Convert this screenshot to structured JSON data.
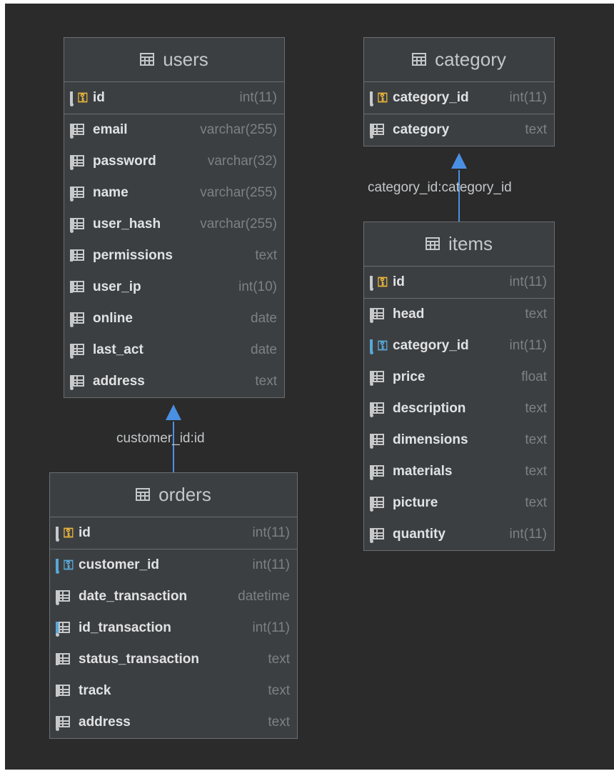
{
  "tables": {
    "users": {
      "name": "users",
      "pk": [
        {
          "name": "id",
          "type": "int(11)"
        }
      ],
      "cols": [
        {
          "name": "email",
          "type": "varchar(255)"
        },
        {
          "name": "password",
          "type": "varchar(32)"
        },
        {
          "name": "name",
          "type": "varchar(255)"
        },
        {
          "name": "user_hash",
          "type": "varchar(255)"
        },
        {
          "name": "permissions",
          "type": "text"
        },
        {
          "name": "user_ip",
          "type": "int(10)"
        },
        {
          "name": "online",
          "type": "date"
        },
        {
          "name": "last_act",
          "type": "date"
        },
        {
          "name": "address",
          "type": "text"
        }
      ]
    },
    "category": {
      "name": "category",
      "pk": [
        {
          "name": "category_id",
          "type": "int(11)"
        }
      ],
      "cols": [
        {
          "name": "category",
          "type": "text"
        }
      ]
    },
    "items": {
      "name": "items",
      "pk": [
        {
          "name": "id",
          "type": "int(11)"
        }
      ],
      "cols": [
        {
          "name": "head",
          "type": "text"
        },
        {
          "name": "category_id",
          "type": "int(11)"
        },
        {
          "name": "price",
          "type": "float"
        },
        {
          "name": "description",
          "type": "text"
        },
        {
          "name": "dimensions",
          "type": "text"
        },
        {
          "name": "materials",
          "type": "text"
        },
        {
          "name": "picture",
          "type": "text"
        },
        {
          "name": "quantity",
          "type": "int(11)"
        }
      ]
    },
    "orders": {
      "name": "orders",
      "pk": [
        {
          "name": "id",
          "type": "int(11)"
        }
      ],
      "cols": [
        {
          "name": "customer_id",
          "type": "int(11)"
        },
        {
          "name": "date_transaction",
          "type": "datetime"
        },
        {
          "name": "id_transaction",
          "type": "int(11)"
        },
        {
          "name": "status_transaction",
          "type": "text"
        },
        {
          "name": "track",
          "type": "text"
        },
        {
          "name": "address",
          "type": "text"
        }
      ]
    }
  },
  "relations": {
    "orders_users": "customer_id:id",
    "items_category": "category_id:category_id"
  },
  "colors": {
    "canvas": "#2b2b2b",
    "table_bg": "#3c3f41",
    "arrow": "#4a90e2",
    "pk_key": "#e8b43c",
    "fk_key": "#59a8d9"
  }
}
